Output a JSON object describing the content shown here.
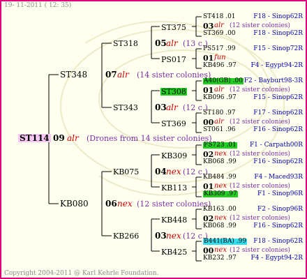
{
  "date_stamp": "19- 11-2011 ( 12: 35)",
  "copyright": "Copyright 2004-2011 @ Karl Kehrle Foundation.",
  "root": {
    "name": "ST114",
    "gen": "09",
    "breed": "alr",
    "note": "(Drones from 14 sister colonies)"
  },
  "level1": [
    {
      "name": "ST348",
      "gen": "07",
      "breed": "alr",
      "note": "(14 sister colonies)"
    },
    {
      "name": "KB080",
      "gen": "06",
      "breed": "nex",
      "note": "(12 sister colonies)"
    }
  ],
  "level2": [
    {
      "name": "ST318",
      "gen": "05",
      "breed": "alr",
      "note": "(13 c.)"
    },
    {
      "name": "ST343",
      "gen": "03",
      "breed": "alr",
      "note": "(12 c.)"
    },
    {
      "name": "KB075",
      "gen": "04",
      "breed": "nex",
      "note": "(12 c.)"
    },
    {
      "name": "KB266",
      "gen": "03",
      "breed": "nex",
      "note": "(12 c.)"
    }
  ],
  "level3": [
    {
      "name": "ST375"
    },
    {
      "name": "PS017"
    },
    {
      "name": "ST308",
      "highlight": "#22cc22"
    },
    {
      "name": "ST369"
    },
    {
      "name": "KB309"
    },
    {
      "name": "KB113"
    },
    {
      "name": "KB448"
    },
    {
      "name": "KB425"
    }
  ],
  "level4": [
    {
      "top": "ST418 .01",
      "top_loc": "F18 - Sinop62R",
      "mid_gen": "03",
      "mid_breed": "alr",
      "mid_note": "(12 sister colonies)",
      "bot": "ST369 .00",
      "bot_loc": "F18 - Sinop62R"
    },
    {
      "top": "PS517 .99",
      "top_loc": "F15 - Sinop72R",
      "mid_gen": "01",
      "mid_breed": "fun",
      "mid_note": "",
      "bot": "KB496 .97",
      "bot_loc": "F4 - Egypt94-2R"
    },
    {
      "top": "A40(GB) .00",
      "top_loc": "F2 - Bayburt98-3R",
      "top_highlight": "#22cc22",
      "mid_gen": "01",
      "mid_breed": "alr",
      "mid_note": "(12 sister colonies)",
      "bot": "KB096 .97",
      "bot_loc": "F15 - Sinop62R"
    },
    {
      "top": "ST180 .97",
      "top_loc": "F17 - Sinop62R",
      "mid_gen": "00",
      "mid_breed": "alr",
      "mid_note": "(12 sister colonies)",
      "bot": "ST061 .96",
      "bot_loc": "F16 - Sinop62R"
    },
    {
      "top": "FS723 .01",
      "top_loc": "F1 - Carpath00R",
      "top_highlight": "#22cc22",
      "mid_gen": "02",
      "mid_breed": "nex",
      "mid_note": "(12 sister colonies)",
      "bot": "KB068 .99",
      "bot_loc": "F16 - Sinop62R"
    },
    {
      "top": "KB484 .99",
      "top_loc": "F4 - Maced93R",
      "mid_gen": "01",
      "mid_breed": "nex",
      "mid_note": "(12 sister colonies)",
      "bot": "KB309 .97",
      "bot_loc": "F1 - Sinop96R",
      "bot_highlight": "#22cc22"
    },
    {
      "top": "KB163 .00",
      "top_loc": "F2 - Sinop96R",
      "mid_gen": "02",
      "mid_breed": "nex",
      "mid_note": "(12 sister colonies)",
      "bot": "KB068 .99",
      "bot_loc": "F16 - Sinop62R"
    },
    {
      "top": "B441(BA) .99",
      "top_loc": "F18 - Sinop62R",
      "top_highlight": "#33ddee",
      "mid_gen": "00",
      "mid_breed": "nex",
      "mid_note": "(12 sister colonies)",
      "bot": "KB232 .97",
      "bot_loc": "F4 - Egypt94-2R"
    }
  ]
}
